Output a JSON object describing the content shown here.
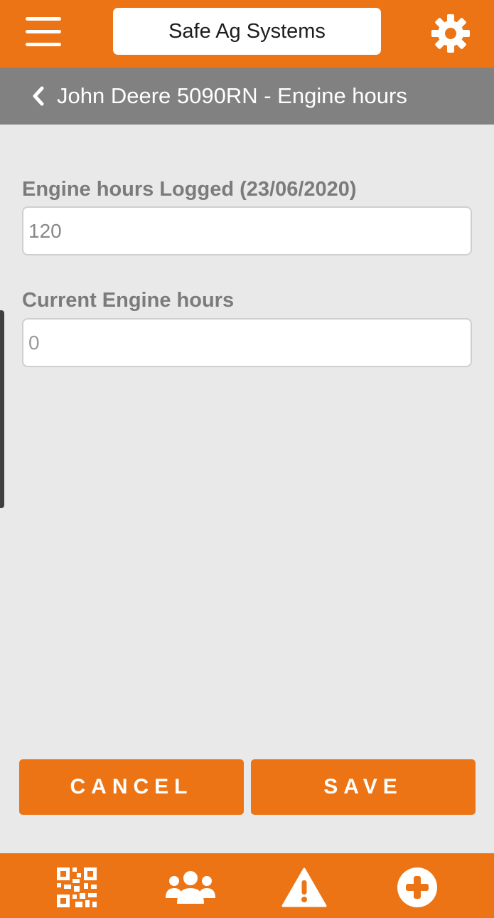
{
  "app": {
    "brand_title": "Safe Ag Systems",
    "accent_color": "#ec7415",
    "subheader_color": "#818181",
    "background_color": "#e9e9e9"
  },
  "topbar": {
    "menu_icon": "hamburger-menu-icon",
    "settings_icon": "gear-icon"
  },
  "subheader": {
    "back_icon": "chevron-left-icon",
    "title": "John Deere 5090RN - Engine hours"
  },
  "form": {
    "logged_label": "Engine hours Logged (23/06/2020)",
    "logged_value": "120",
    "current_label": "Current Engine hours",
    "current_placeholder": "0"
  },
  "actions": {
    "cancel_label": "CANCEL",
    "save_label": "SAVE"
  },
  "bottom_nav": {
    "items": [
      {
        "icon": "qr-code-icon"
      },
      {
        "icon": "people-icon"
      },
      {
        "icon": "warning-icon"
      },
      {
        "icon": "plus-circle-icon"
      }
    ]
  }
}
